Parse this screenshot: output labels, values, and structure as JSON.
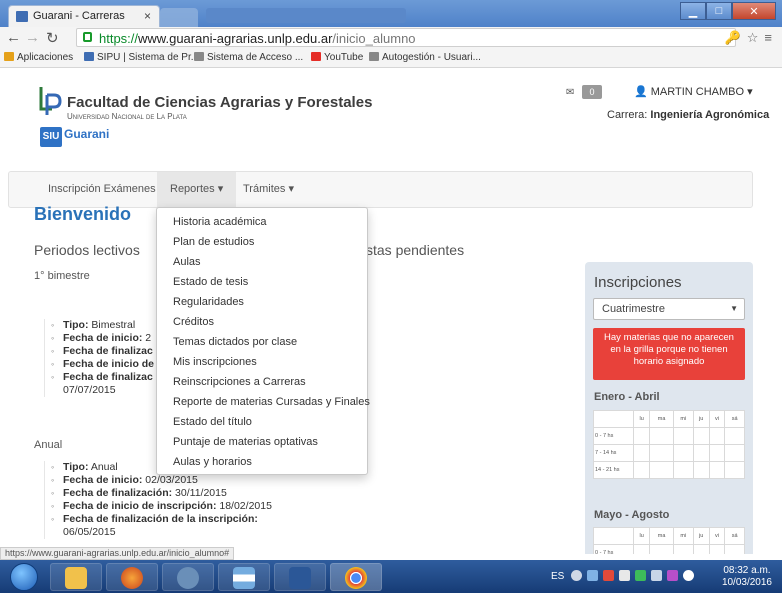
{
  "browser": {
    "tab_title": "Guarani - Carreras",
    "tab_close": "×",
    "url_scheme": "https://",
    "url_host": "www.guarani-agrarias.unlp.edu.ar",
    "url_path": "/inicio_alumno",
    "bookmarks": [
      {
        "label": "Aplicaciones",
        "color": "#e5a11a"
      },
      {
        "label": "SIPU | Sistema de Pr...",
        "color": "#3f6db3"
      },
      {
        "label": "Sistema de Acceso ...",
        "color": "#888888"
      },
      {
        "label": "YouTube",
        "color": "#e52d27"
      },
      {
        "label": "Autogestión - Usuari...",
        "color": "#888888"
      }
    ],
    "status_url": "https://www.guarani-agrarias.unlp.edu.ar/inicio_alumno#"
  },
  "header": {
    "faculty": "Facultad de Ciencias Agrarias y Forestales",
    "university": "Universidad Nacional de La Plata",
    "siu": "SIU",
    "guarani": "Guarani",
    "messages_count": "0",
    "user": "MARTIN CHAMBO",
    "carrera_label": "Carrera:",
    "carrera_value": "Ingeniería Agronómica"
  },
  "nav": {
    "inscripcion": "Inscripción Exámenes",
    "reportes": "Reportes",
    "tramites": "Trámites"
  },
  "dropdown": [
    "Historia académica",
    "Plan de estudios",
    "Aulas",
    "Estado de tesis",
    "Regularidades",
    "Créditos",
    "Temas dictados por clase",
    "Mis inscripciones",
    "Reinscripciones a Carreras",
    "Reporte de materias Cursadas y Finales",
    "Estado del título",
    "Puntaje de materias optativas",
    "Aulas y horarios"
  ],
  "main": {
    "welcome": "Bienvenido",
    "periodos_title": "Periodos lectivos",
    "pendientes_partial": "stas pendientes",
    "bimestre": {
      "title": "1° bimestre",
      "tipo_label": "Tipo:",
      "tipo": "Bimestral",
      "inicio_label": "Fecha de inicio:",
      "inicio_partial": "2",
      "finalizacion_label": "Fecha de finalizac",
      "inicio_insc_label": "Fecha de inicio de",
      "fin_insc_label": "Fecha de finalizac",
      "fin_insc_value": "07/07/2015"
    },
    "anual": {
      "title": "Anual",
      "tipo_label": "Tipo:",
      "tipo": "Anual",
      "inicio_label": "Fecha de inicio:",
      "inicio": "02/03/2015",
      "finalizacion_label": "Fecha de finalización:",
      "finalizacion": "30/11/2015",
      "inicio_insc_label": "Fecha de inicio de inscripción:",
      "inicio_insc": "18/02/2015",
      "fin_insc_label": "Fecha de finalización de la inscripción:",
      "fin_insc": "06/05/2015"
    }
  },
  "inscripciones": {
    "title": "Inscripciones",
    "select_value": "Cuatrimestre",
    "alert": "Hay materias que no aparecen en la grilla porque no tienen horario asignado",
    "period1": "Enero - Abril",
    "period2": "Mayo - Agosto",
    "days": [
      "lu",
      "ma",
      "mi",
      "ju",
      "vi",
      "sá"
    ],
    "rows": [
      "0 - 7 hs",
      "7 - 14 hs",
      "14 - 21 hs"
    ]
  },
  "taskbar": {
    "lang": "ES",
    "time": "08:32 a.m.",
    "date": "10/03/2016"
  }
}
